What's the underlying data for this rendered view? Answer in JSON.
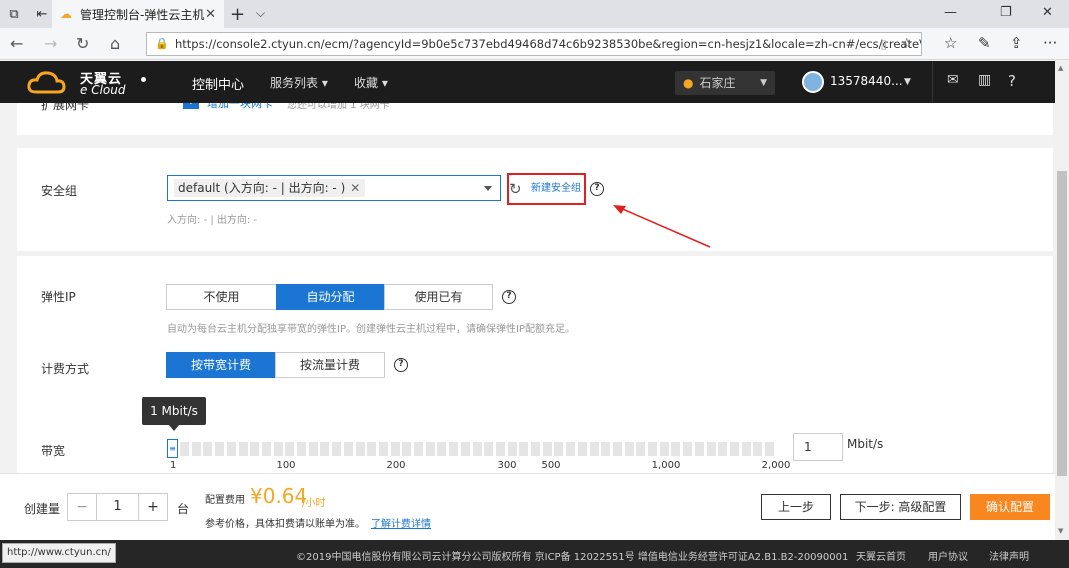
{
  "browser": {
    "tab_title": "管理控制台-弹性云主机",
    "url": "https://console2.ctyun.cn/ecm/?agencyId=9b0e5c737ebd49468d74c6b9238530be&region=cn-hesjz1&locale=zh-cn#/ecs/createVm",
    "status_url": "http://www.ctyun.cn/"
  },
  "header": {
    "logo_cn": "天翼云",
    "logo_en": "e Cloud",
    "nav": {
      "console": "控制中心",
      "services": "服务列表 ▾",
      "favorites": "收藏 ▾"
    },
    "city": "石家庄",
    "user": "13578440...",
    "colors": {
      "bg": "#1c1c1c",
      "accent": "#f5a623"
    }
  },
  "nic": {
    "label": "扩展网卡",
    "link": "增加一块网卡",
    "hint": "您还可以增加 1 块网卡"
  },
  "security_group": {
    "label": "安全组",
    "selected": "default (入方向: - | 出方向: - )",
    "new_link": "新建安全组",
    "rule_hint": "入方向: - | 出方向: -"
  },
  "eip": {
    "label": "弹性IP",
    "options": [
      "不使用",
      "自动分配",
      "使用已有"
    ],
    "selected_index": 1,
    "hint": "自动为每台云主机分配独享带宽的弹性IP。创建弹性云主机过程中，请确保弹性IP配额充足。"
  },
  "billing": {
    "label": "计费方式",
    "options": [
      "按带宽计费",
      "按流量计费"
    ],
    "selected_index": 0
  },
  "bandwidth": {
    "label": "带宽",
    "tooltip": "1 Mbit/s",
    "value": "1",
    "unit": "Mbit/s",
    "ticks": [
      "1",
      "100",
      "200",
      "300",
      "500",
      "1,000",
      "2,000"
    ]
  },
  "footer": {
    "quantity_label": "创建量",
    "minus": "−",
    "quantity": "1",
    "plus": "+",
    "unit": "台",
    "fee_label": "配置费用",
    "price": "¥0.64",
    "price_unit": "/小时",
    "note": "参考价格，具体扣费请以账单为准。",
    "note_link": "了解计费详情",
    "prev": "上一步",
    "next": "下一步: 高级配置",
    "confirm": "确认配置"
  },
  "site_footer": {
    "copyright": "©2019中国电信股份有限公司云计算分公司版权所有 京ICP备 12022551号 增值电信业务经营许可证A2.B1.B2-20090001",
    "links": [
      "天翼云首页",
      "用户协议",
      "法律声明"
    ]
  }
}
